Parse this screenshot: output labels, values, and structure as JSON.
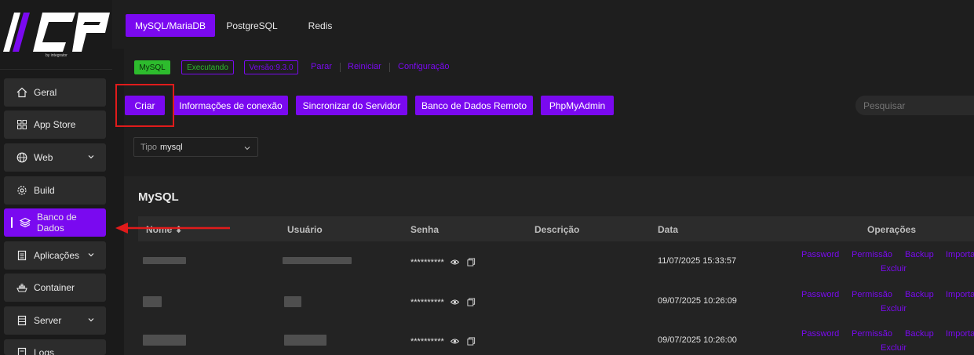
{
  "sidebar": {
    "logo_text": "ICP",
    "logo_sub": "by integrator",
    "items": [
      {
        "label": "Geral",
        "icon": "home-icon"
      },
      {
        "label": "App Store",
        "icon": "grid-icon"
      },
      {
        "label": "Web",
        "icon": "globe-icon"
      },
      {
        "label": "Build",
        "icon": "gear-icon"
      },
      {
        "label": "Banco de Dados",
        "icon": "database-icon"
      },
      {
        "label": "Aplicações",
        "icon": "document-icon"
      },
      {
        "label": "Container",
        "icon": "container-icon"
      },
      {
        "label": "Server",
        "icon": "server-icon"
      },
      {
        "label": "Logs",
        "icon": "logs-icon"
      }
    ]
  },
  "tabs": [
    {
      "label": "MySQL/MariaDB"
    },
    {
      "label": "PostgreSQL"
    },
    {
      "label": "Redis"
    }
  ],
  "status": {
    "service": "MySQL",
    "state": "Executando",
    "version": "Versão:9.3.0",
    "links": [
      "Parar",
      "Reiniciar",
      "Configuração"
    ]
  },
  "actions": [
    "Criar",
    "Informações de conexão",
    "Sincronizar do Servidor",
    "Banco de Dados Remoto",
    "PhpMyAdmin"
  ],
  "search": {
    "placeholder": "Pesquisar"
  },
  "filter": {
    "label": "Tipo",
    "value": "mysql"
  },
  "table": {
    "title": "MySQL",
    "columns": [
      "Nome ⬍",
      "Usuário",
      "Senha",
      "Descrição",
      "Data",
      "Operações"
    ],
    "rows": [
      {
        "password": "**********",
        "date": "11/07/2025 15:33:57"
      },
      {
        "password": "**********",
        "date": "09/07/2025 10:26:09"
      },
      {
        "password": "**********",
        "date": "09/07/2025 10:26:00"
      }
    ],
    "operations": [
      "Password",
      "Permissão",
      "Backup",
      "Importar",
      "Excluir"
    ]
  },
  "colors": {
    "accent": "#7a09f0",
    "running": "#2dbb2d",
    "highlight": "#e01b1b"
  }
}
